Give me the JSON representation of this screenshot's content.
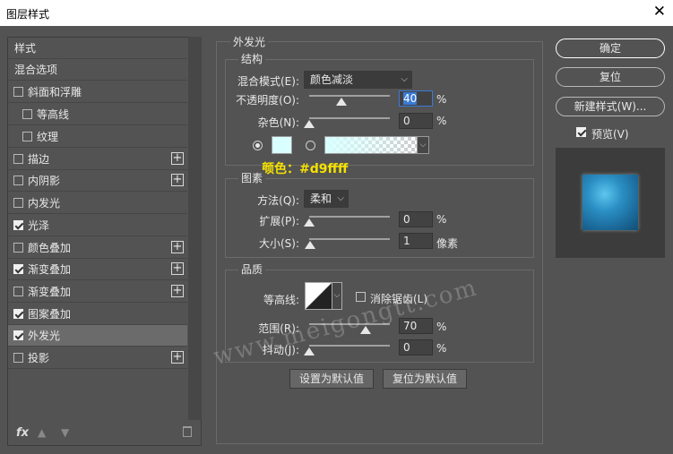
{
  "dialog": {
    "title": "图层样式",
    "close_glyph": "✕"
  },
  "left": {
    "items": [
      {
        "label": "样式"
      },
      {
        "label": "混合选项"
      },
      {
        "label": "斜面和浮雕",
        "checked": false
      },
      {
        "label": "等高线",
        "checked": false
      },
      {
        "label": "纹理",
        "checked": false
      },
      {
        "label": "描边",
        "checked": false
      },
      {
        "label": "内阴影",
        "checked": false
      },
      {
        "label": "内发光",
        "checked": false
      },
      {
        "label": "光泽",
        "checked": true
      },
      {
        "label": "颜色叠加",
        "checked": false
      },
      {
        "label": "渐变叠加",
        "checked": true
      },
      {
        "label": "渐变叠加",
        "checked": false
      },
      {
        "label": "图案叠加",
        "checked": true
      },
      {
        "label": "外发光",
        "checked": true,
        "selected": true
      },
      {
        "label": "投影",
        "checked": false
      }
    ],
    "fx_label": "fx",
    "up_glyph": "▲",
    "down_glyph": "▼",
    "plus_glyph": "+"
  },
  "outer_glow": {
    "section_title": "外发光",
    "structure": {
      "title": "结构",
      "blend_mode_label": "混合模式(E):",
      "blend_mode_value": "颜色减淡",
      "opacity_label": "不透明度(O):",
      "opacity_value": "40",
      "opacity_percent": 40,
      "noise_label": "杂色(N):",
      "noise_value": "0",
      "noise_percent": 0,
      "unit_percent": "%",
      "glow_color": "#d9ffff",
      "color_annotation": "颜色：#d9ffff"
    },
    "elements": {
      "title": "图素",
      "technique_label": "方法(Q):",
      "technique_value": "柔和",
      "spread_label": "扩展(P):",
      "spread_value": "0",
      "spread_percent": 0,
      "size_label": "大小(S):",
      "size_value": "1",
      "size_unit": "像素"
    },
    "quality": {
      "title": "品质",
      "contour_label": "等高线:",
      "antialias_label": "消除锯齿(L)",
      "antialias_checked": false,
      "range_label": "范围(R):",
      "range_value": "70",
      "range_percent": 70,
      "jitter_label": "抖动(J):",
      "jitter_value": "0",
      "jitter_percent": 0
    },
    "make_default": "设置为默认值",
    "reset_default": "复位为默认值"
  },
  "right": {
    "ok": "确定",
    "reset": "复位",
    "new_style": "新建样式(W)...",
    "preview_label": "预览(V)",
    "preview_checked": true
  },
  "watermark": "www.meigongtt.com",
  "dropdown_glyph": "⌵"
}
